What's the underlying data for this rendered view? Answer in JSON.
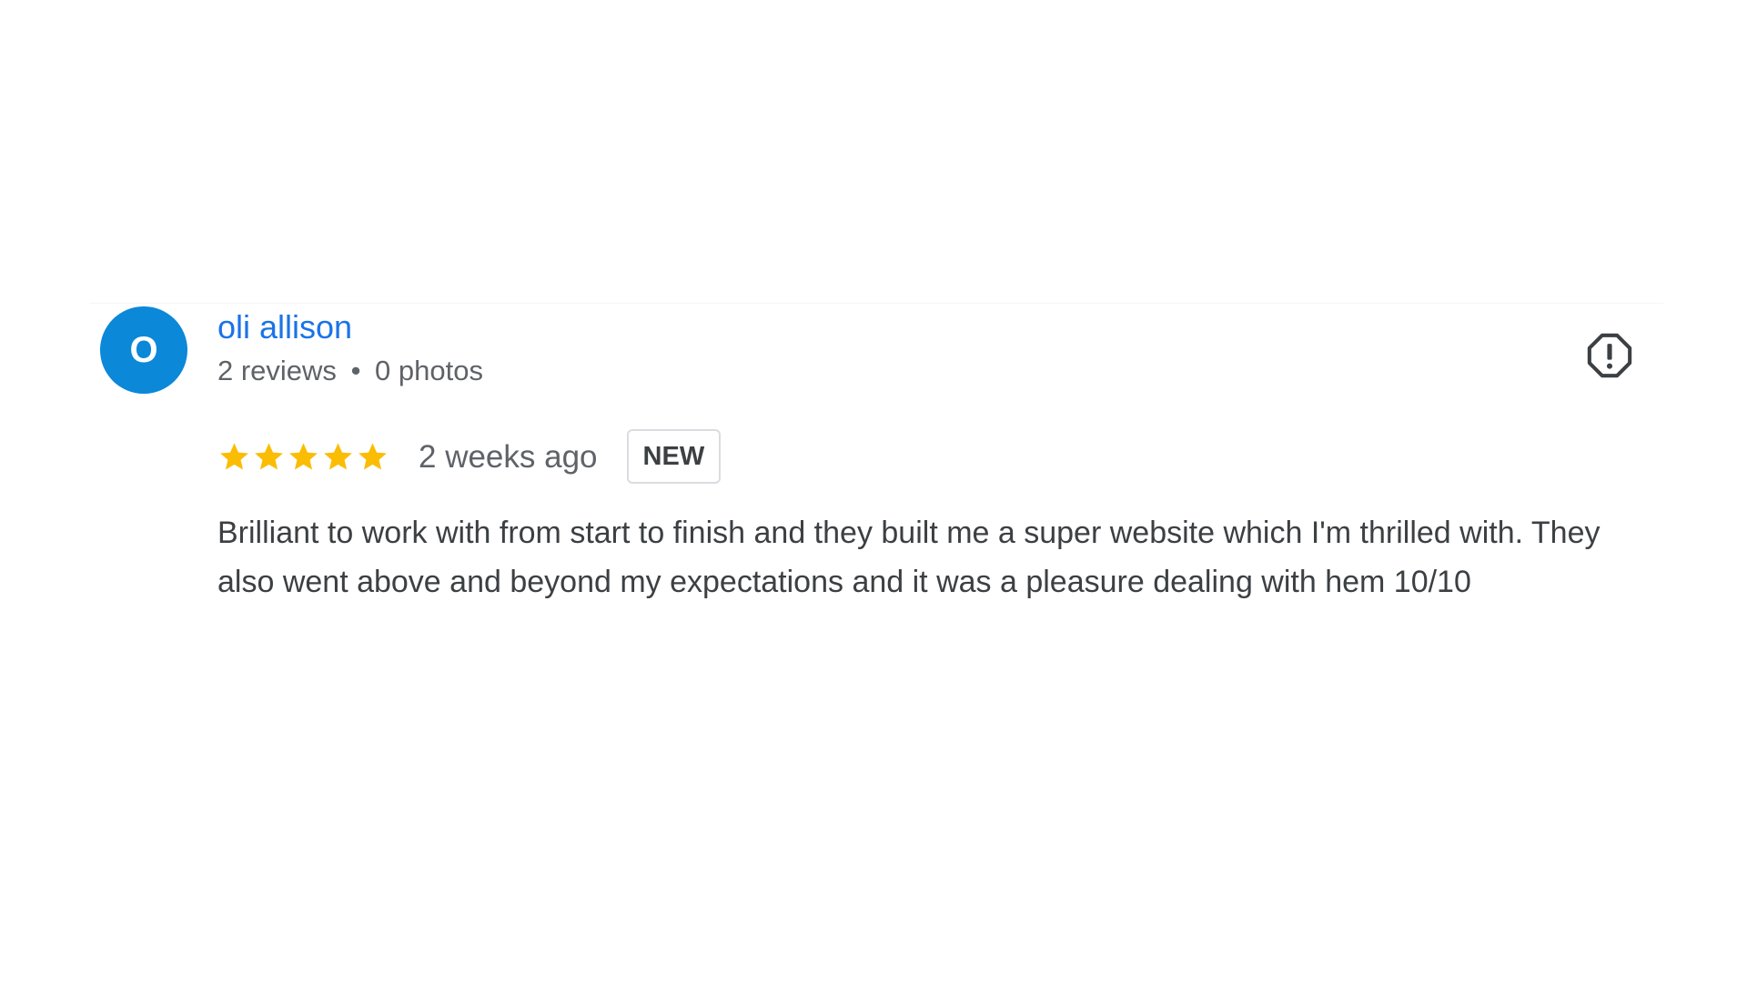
{
  "review": {
    "avatar_initial": "O",
    "reviewer_name": "oli allison",
    "reviews_count": "2 reviews",
    "meta_separator": "•",
    "photos_count": "0 photos",
    "rating": 5,
    "rating_max": 5,
    "date": "2 weeks ago",
    "badge": "NEW",
    "text": "Brilliant to work with from start to finish and they built me a super website which I'm thrilled with. They also went above and beyond my expectations and it was a pleasure dealing with hem 10/10"
  },
  "icons": {
    "star": "star-icon",
    "report": "report-flag-icon"
  },
  "colors": {
    "avatar_bg": "#0b88d8",
    "name": "#1a73e8",
    "star": "#fbbc04",
    "meta": "#5f6368",
    "body_text": "#3c4043",
    "badge_border": "#dadce0"
  }
}
